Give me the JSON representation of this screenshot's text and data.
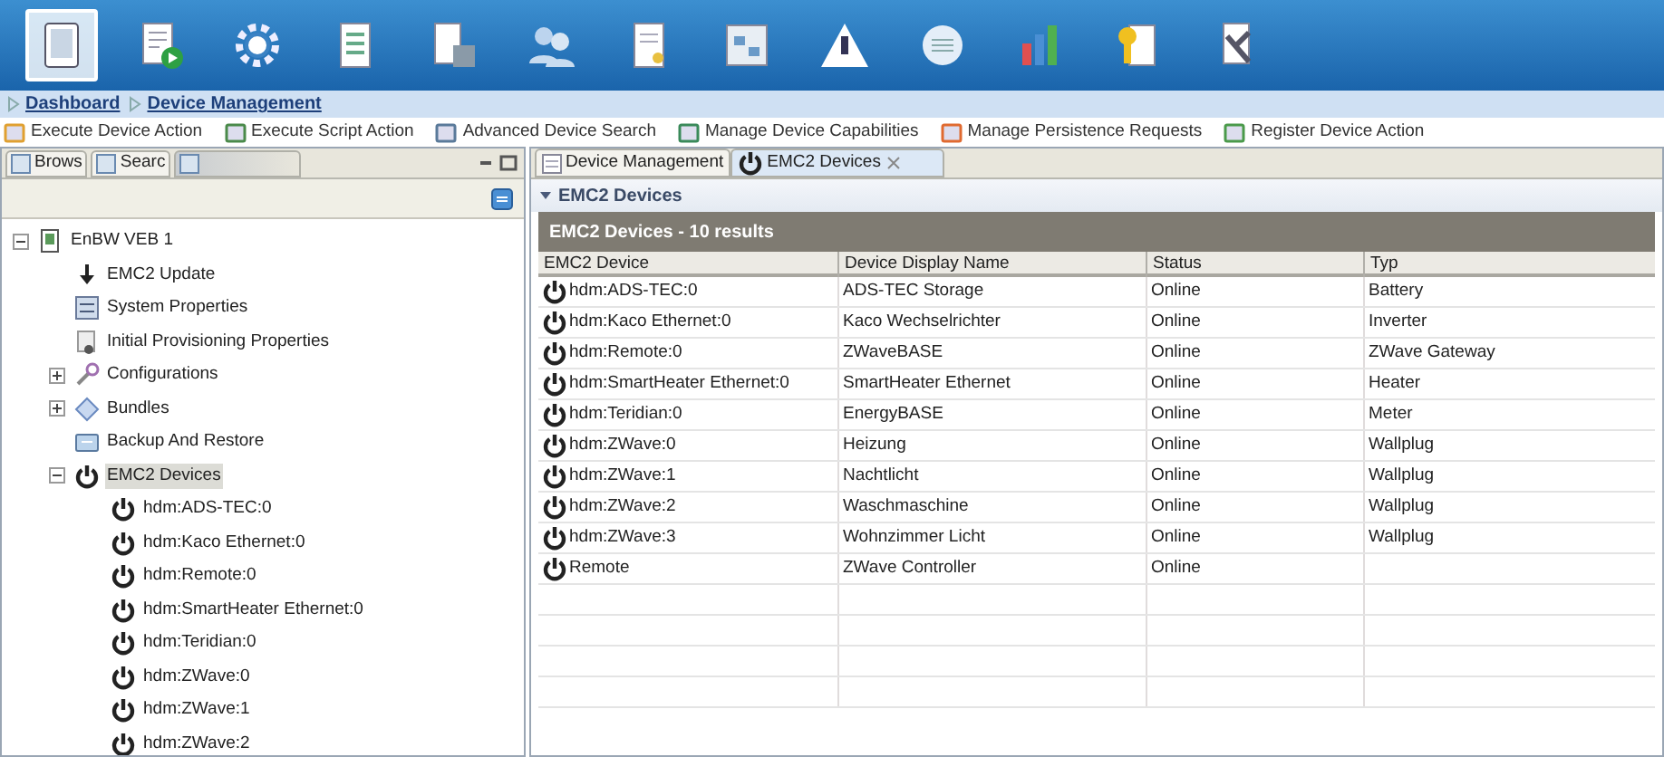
{
  "toolbar": [
    {
      "kind": "tablet",
      "selected": true
    },
    {
      "kind": "doc-play",
      "selected": false
    },
    {
      "kind": "gear",
      "selected": false
    },
    {
      "kind": "list",
      "selected": false
    },
    {
      "kind": "doc-chart",
      "selected": false
    },
    {
      "kind": "users",
      "selected": false
    },
    {
      "kind": "doc",
      "selected": false
    },
    {
      "kind": "grid",
      "selected": false
    },
    {
      "kind": "warning",
      "selected": false
    },
    {
      "kind": "circle",
      "selected": false
    },
    {
      "kind": "bars",
      "selected": false
    },
    {
      "kind": "key-doc",
      "selected": false
    },
    {
      "kind": "tools",
      "selected": false
    }
  ],
  "breadcrumb": [
    "Dashboard",
    "Device Management"
  ],
  "actions": [
    {
      "label": "Execute Device Action",
      "kind": "run"
    },
    {
      "label": "Execute Script Action",
      "kind": "script"
    },
    {
      "label": "Advanced Device Search",
      "kind": "search"
    },
    {
      "label": "Manage Device Capabilities",
      "kind": "manage"
    },
    {
      "label": "Manage Persistence Requests",
      "kind": "persist"
    },
    {
      "label": "Register Device Action",
      "kind": "register"
    }
  ],
  "left_panel": {
    "tabs": [
      {
        "label": "Brows",
        "selected": false
      },
      {
        "label": "Searc",
        "selected": false
      },
      {
        "selected": true
      }
    ],
    "tree": [
      {
        "label": "EnBW VEB 1",
        "kind": "device",
        "expanded": true,
        "children": [
          {
            "label": "EMC2 Update",
            "kind": "download"
          },
          {
            "label": "System Properties",
            "kind": "properties"
          },
          {
            "label": "Initial Provisioning Properties",
            "kind": "provisioning"
          },
          {
            "label": "Configurations",
            "kind": "config",
            "expanded": false
          },
          {
            "label": "Bundles",
            "kind": "bundle",
            "expanded": false
          },
          {
            "label": "Backup And Restore",
            "kind": "backup"
          },
          {
            "label": "EMC2 Devices",
            "kind": "power",
            "expanded": true,
            "selected": true,
            "children": [
              {
                "label": "hdm:ADS-TEC:0",
                "kind": "power"
              },
              {
                "label": "hdm:Kaco Ethernet:0",
                "kind": "power"
              },
              {
                "label": "hdm:Remote:0",
                "kind": "power"
              },
              {
                "label": "hdm:SmartHeater Ethernet:0",
                "kind": "power"
              },
              {
                "label": "hdm:Teridian:0",
                "kind": "power"
              },
              {
                "label": "hdm:ZWave:0",
                "kind": "power"
              },
              {
                "label": "hdm:ZWave:1",
                "kind": "power"
              },
              {
                "label": "hdm:ZWave:2",
                "kind": "power"
              }
            ]
          }
        ]
      }
    ]
  },
  "editor_tabs": [
    {
      "label": "Device Management",
      "selected": false
    },
    {
      "label": "EMC2 Devices",
      "selected": true
    }
  ],
  "section": {
    "title": "EMC2 Devices",
    "expanded": true
  },
  "table": {
    "title": "EMC2 Devices - 10 results",
    "columns": [
      "EMC2 Device",
      "Device Display Name",
      "Status",
      "Typ"
    ],
    "rows": [
      [
        "hdm:ADS-TEC:0",
        "ADS-TEC Storage",
        "Online",
        "Battery"
      ],
      [
        "hdm:Kaco Ethernet:0",
        "Kaco Wechselrichter",
        "Online",
        "Inverter"
      ],
      [
        "hdm:Remote:0",
        "ZWaveBASE",
        "Online",
        "ZWave Gateway"
      ],
      [
        "hdm:SmartHeater Ethernet:0",
        "SmartHeater Ethernet",
        "Online",
        "Heater"
      ],
      [
        "hdm:Teridian:0",
        "EnergyBASE",
        "Online",
        "Meter"
      ],
      [
        "hdm:ZWave:0",
        "Heizung",
        "Online",
        "Wallplug"
      ],
      [
        "hdm:ZWave:1",
        "Nachtlicht",
        "Online",
        "Wallplug"
      ],
      [
        "hdm:ZWave:2",
        "Waschmaschine",
        "Online",
        "Wallplug"
      ],
      [
        "hdm:ZWave:3",
        "Wohnzimmer Licht",
        "Online",
        "Wallplug"
      ],
      [
        "Remote",
        "ZWave Controller",
        "Online",
        ""
      ]
    ]
  }
}
